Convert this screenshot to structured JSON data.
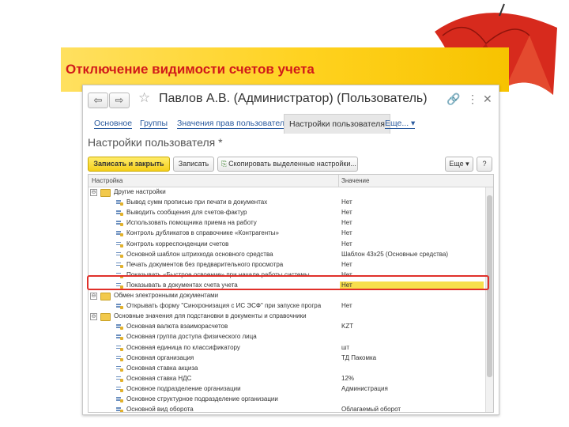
{
  "slide": {
    "title": "Отключение видимости счетов учета",
    "accent_color": "#d11a1a",
    "banner_color": "#ffd21f"
  },
  "window": {
    "title": "Павлов А.В. (Администратор) (Пользователь)",
    "nav": {
      "back_icon": "arrow-left-icon",
      "forward_icon": "arrow-right-icon",
      "favorite_icon": "star-icon",
      "link_icon": "link-icon",
      "menu_icon": "more-vertical-icon",
      "close_icon": "close-icon"
    },
    "tabs": [
      {
        "label": "Основное"
      },
      {
        "label": "Группы"
      },
      {
        "label": "Значения прав пользователя"
      },
      {
        "label": "Настройки пользователя",
        "active": true
      },
      {
        "label": "Еще... ▾"
      }
    ],
    "form_title": "Настройки пользователя *",
    "toolbar": {
      "save_close": "Записать и закрыть",
      "save": "Записать",
      "copy": "Скопировать выделенные настройки...",
      "more": "Еще ▾",
      "help": "?"
    }
  },
  "table": {
    "columns": [
      "Настройка",
      "Значение"
    ],
    "rows": [
      {
        "type": "group",
        "toggle": "⊖",
        "name": "Другие настройки",
        "value": ""
      },
      {
        "type": "item",
        "name": "Вывод сумм прописью при печати в документах",
        "value": "Нет"
      },
      {
        "type": "item",
        "name": "Выводить сообщения для счетов-фактур",
        "value": "Нет"
      },
      {
        "type": "item",
        "name": "Использовать помощника приема на работу",
        "value": "Нет"
      },
      {
        "type": "item",
        "name": "Контроль дубликатов в справочнике «Контрагенты»",
        "value": "Нет"
      },
      {
        "type": "item",
        "name": "Контроль корреспонденции счетов",
        "value": "Нет"
      },
      {
        "type": "item",
        "name": "Основной шаблон штрихкода основного средства",
        "value": "Шаблон 43x25 (Основные средства)"
      },
      {
        "type": "item",
        "name": "Печать документов без предварительного просмотра",
        "value": "Нет"
      },
      {
        "type": "item",
        "name": "Показывать «Быстрое освоение» при начале работы системы",
        "value": "Нет"
      },
      {
        "type": "item",
        "name": "Показывать в документах счета учета",
        "value": "Нет",
        "selected": true
      },
      {
        "type": "group",
        "toggle": "⊖",
        "name": "Обмен электронными документами",
        "value": ""
      },
      {
        "type": "item",
        "name": "Открывать форму \"Синхронизация с ИС ЭСФ\" при запуске програ",
        "value": "Нет"
      },
      {
        "type": "group",
        "toggle": "⊖",
        "name": "Основные значения для подстановки в документы и справочники",
        "value": ""
      },
      {
        "type": "item",
        "name": "Основная валюта взаиморасчетов",
        "value": "KZT"
      },
      {
        "type": "item",
        "name": "Основная группа доступа физического лица",
        "value": ""
      },
      {
        "type": "item",
        "name": "Основная единица по классификатору",
        "value": "шт"
      },
      {
        "type": "item",
        "name": "Основная организация",
        "value": "ТД Пакомка"
      },
      {
        "type": "item",
        "name": "Основная ставка акциза",
        "value": ""
      },
      {
        "type": "item",
        "name": "Основная ставка НДС",
        "value": "12%"
      },
      {
        "type": "item",
        "name": "Основное подразделение организации",
        "value": "Администрация"
      },
      {
        "type": "item",
        "name": "Основное структурное подразделение организации",
        "value": ""
      },
      {
        "type": "item",
        "name": "Основной вид оборота",
        "value": "Облагаемый оборот"
      }
    ]
  },
  "highlight_color": "#e0302a",
  "selection_color": "#f7df4d"
}
